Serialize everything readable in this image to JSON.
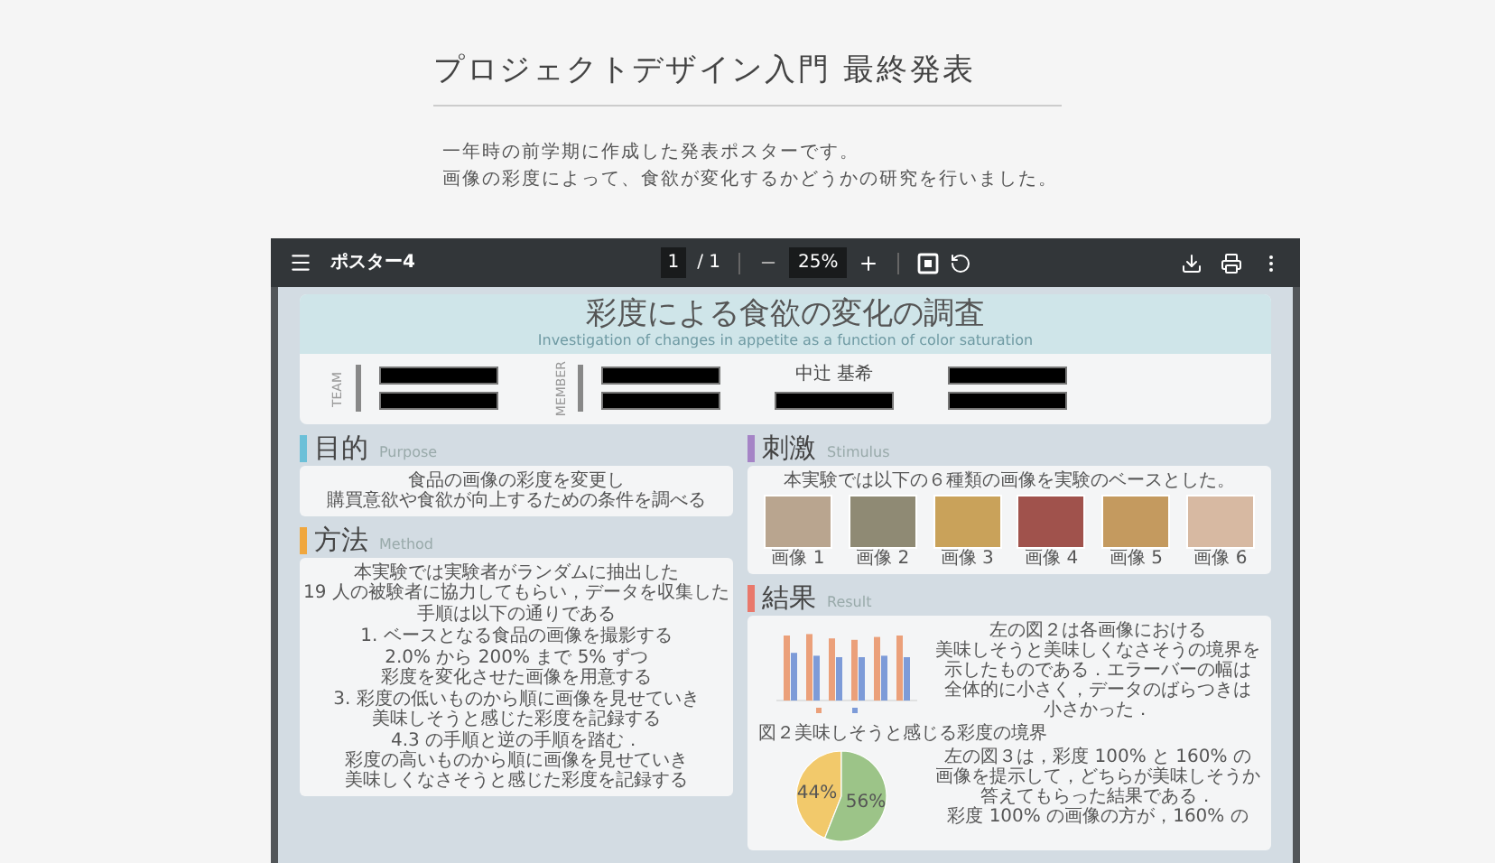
{
  "page": {
    "title": "プロジェクトデザイン入門 最終発表",
    "description": [
      "一年時の前学期に作成した発表ポスターです。",
      "画像の彩度によって、食欲が変化するかどうかの研究を行いました。"
    ]
  },
  "viewer": {
    "file_name": "ポスター4",
    "page_current": "1",
    "page_total": "/ 1",
    "zoom": "25%"
  },
  "poster": {
    "title": "彩度による食欲の変化の調査",
    "subtitle": "Investigation of changes in appetite as a function of color saturation",
    "team": {
      "label": "TEAM",
      "entries": [
        {
          "kind": "redacted"
        },
        {
          "kind": "redacted"
        }
      ]
    },
    "member": {
      "label": "MEMBER",
      "entries": [
        {
          "kind": "redacted"
        },
        {
          "kind": "name",
          "text": "中辻 基希"
        },
        {
          "kind": "redacted"
        },
        {
          "kind": "redacted"
        },
        {
          "kind": "redacted"
        },
        {
          "kind": "redacted"
        }
      ]
    },
    "left_sections": [
      {
        "kind": "text",
        "heading": "目的",
        "heading_en": "Purpose",
        "color": "#6cc0d8",
        "paragraphs": [
          [
            "食品の画像の彩度を変更し",
            "購買意欲や食欲が向上するための条件を調べる"
          ]
        ]
      },
      {
        "kind": "text",
        "heading": "方法",
        "heading_en": "Method",
        "color": "#f0a73e",
        "paragraphs": [
          [
            "本実験では実験者がランダムに抽出した",
            "19 人の被験者に協力してもらい，データを収集した"
          ],
          [
            "手順は以下の通りである"
          ],
          [
            "1. ベースとなる食品の画像を撮影する"
          ],
          [
            "2.0% から 200% まで 5% ずつ",
            "彩度を変化させた画像を用意する"
          ],
          [
            "3. 彩度の低いものから順に画像を見せていき",
            "美味しそうと感じた彩度を記録する"
          ],
          [
            "4.3 の手順と逆の手順を踏む．",
            "彩度の高いものから順に画像を見せていき",
            "美味しくなさそうと感じた彩度を記録する"
          ]
        ]
      }
    ],
    "right_sections": [
      {
        "kind": "stimulus",
        "heading": "刺激",
        "heading_en": "Stimulus",
        "color": "#a584c6",
        "text": "本実験では以下の６種類の画像を実験のベースとした。",
        "images": [
          {
            "label": "画像 1"
          },
          {
            "label": "画像 2"
          },
          {
            "label": "画像 3"
          },
          {
            "label": "画像 4"
          },
          {
            "label": "画像 5"
          },
          {
            "label": "画像 6"
          }
        ]
      },
      {
        "kind": "result",
        "heading": "結果",
        "heading_en": "Result",
        "color": "#e9786b",
        "caption": "図２美味しそうと感じる彩度の境界",
        "paragraph_1": [
          "左の図２は各画像における",
          "美味しそうと美味しくなさそうの境界を",
          "示したものである．エラーバーの幅は",
          "全体的に小さく，データのばらつきは",
          "小さかった．"
        ],
        "paragraph_2": [
          "左の図３は，彩度 100% と 160% の",
          "画像を提示して，どちらが美味しそうか",
          "答えてもらった結果である．",
          "彩度 100% の画像の方が，160% の"
        ],
        "chart_data": {
          "type": "pie",
          "values": [
            44,
            56
          ],
          "value_labels": [
            "44%",
            "56%"
          ]
        }
      }
    ]
  }
}
